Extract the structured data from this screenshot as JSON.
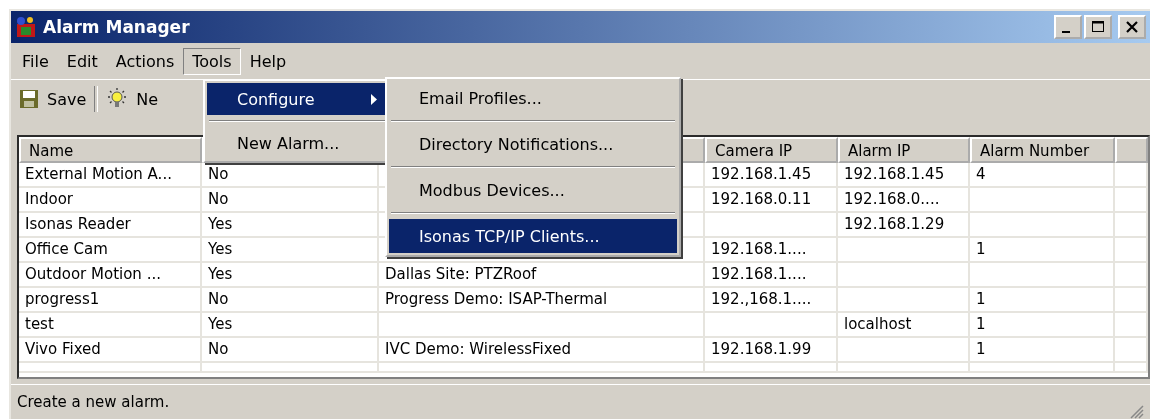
{
  "window": {
    "title": "Alarm Manager"
  },
  "menu_bar": [
    {
      "label": "File",
      "selected": false
    },
    {
      "label": "Edit",
      "selected": false
    },
    {
      "label": "Actions",
      "selected": false
    },
    {
      "label": "Tools",
      "selected": true
    },
    {
      "label": "Help",
      "selected": false
    }
  ],
  "toolbar": [
    {
      "label": "Save",
      "kind": "save"
    },
    {
      "label": "Ne",
      "kind": "new"
    }
  ],
  "tools_menu": [
    {
      "label": "Configure",
      "selected": true,
      "submenu": true
    },
    {
      "label": "New Alarm...",
      "selected": false,
      "submenu": false
    }
  ],
  "configure_submenu": [
    {
      "label": "Email Profiles...",
      "selected": false
    },
    {
      "label": "Directory Notifications...",
      "selected": false
    },
    {
      "label": "Modbus Devices...",
      "selected": false
    },
    {
      "label": "Isonas TCP/IP Clients...",
      "selected": true
    }
  ],
  "table": {
    "columns": [
      {
        "label": "Name"
      },
      {},
      {},
      {
        "label": "Camera IP"
      },
      {
        "label": "Alarm IP"
      },
      {
        "label": "Alarm Number"
      }
    ],
    "rows": [
      [
        "External Motion A...",
        "No",
        "",
        "192.168.1.45",
        "192.168.1.45",
        "4"
      ],
      [
        "Indoor",
        "No",
        "",
        "192.168.0.11",
        "192.168.0....",
        ""
      ],
      [
        "Isonas Reader",
        "Yes",
        "",
        "",
        "192.168.1.29",
        ""
      ],
      [
        "Office Cam",
        "Yes",
        "",
        "192.168.1....",
        "",
        "1"
      ],
      [
        "Outdoor Motion ...",
        "Yes",
        "Dallas Site: PTZRoof",
        "192.168.1....",
        "",
        ""
      ],
      [
        "progress1",
        "No",
        "Progress Demo: ISAP-Thermal",
        "192.,168.1....",
        "",
        "1"
      ],
      [
        "test",
        "Yes",
        "",
        "",
        "localhost",
        "1"
      ],
      [
        "Vivo Fixed",
        "No",
        "IVC Demo: WirelessFixed",
        "192.168.1.99",
        "",
        "1"
      ]
    ]
  },
  "status_bar": "Create a new alarm."
}
